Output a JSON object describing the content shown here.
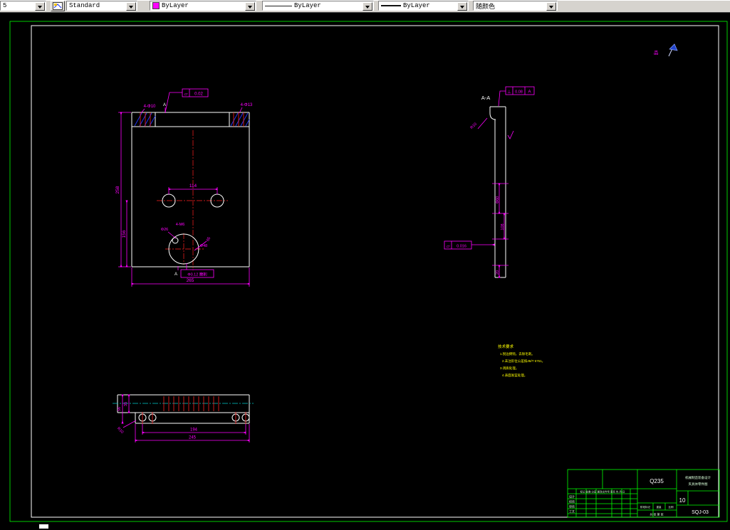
{
  "toolbar": {
    "left_combo_value": "5",
    "text_style": "Standard",
    "color": "ByLayer",
    "linetype": "ByLayer",
    "lineweight": "ByLayer",
    "plot_style": "随颜色"
  },
  "colors": {
    "dimension": "#ff00ff",
    "outline": "#ffffff",
    "centerline": "#ff2020",
    "hatch": "#2233ee",
    "frame": "#00ff00",
    "notes": "#ffff00",
    "aux_centerline": "#00c8c8",
    "toolbar_bg": "#d6d3ce"
  },
  "front_view": {
    "holes_left": "4-Φ10",
    "holes_right": "4-Φ13",
    "fcf_symbol": "▱",
    "fcf_value": "0.02",
    "section_label_top": "A",
    "section_label_bottom": "A",
    "dim_width_holes": "114",
    "dim_height": "258",
    "dim_height2": "156",
    "dim_width": "265",
    "label_phi26": "Φ26",
    "label_m6": "4-M6",
    "label_phi48": "Φ48",
    "label_angle": "65",
    "basic_note": "Φ0.12 磨削"
  },
  "side_view": {
    "section_title": "A-A",
    "fcf_perp_symbol": "⊥",
    "fcf_perp_value": "0.08",
    "fcf_perp_datum": "A",
    "fillet": "R10",
    "dim_phi60": "Φ60",
    "dim_108": "108",
    "dim_20": "20",
    "fcf_flat_symbol": "▱",
    "fcf_flat_value": "0.016"
  },
  "bottom_view": {
    "dim_35": "35",
    "dim_56": "56",
    "fillet": "R10",
    "dim_194": "194",
    "dim_245": "245"
  },
  "notes": {
    "title": "技术要求",
    "lines": [
      "1.锐边倒钝，去除毛刺。",
      "2.未注形位公差按JB/T 5751。",
      "3.调质处理。",
      "4.表面发蓝处理。"
    ]
  },
  "title_block": {
    "material": "Q235",
    "part_no": "SQJ-03",
    "qty": "10",
    "org_line1": "机械制造装备设计",
    "org_line2": "夹具体零件图",
    "header_row": "标记 处数 分区 更改文件号 签名 年.月.日",
    "rows": [
      "设计",
      "校核",
      "审核",
      "工艺"
    ],
    "stage": "阶段标记",
    "weight": "重量",
    "scale": "比例",
    "sheet": "共 张 第 张"
  },
  "markers": {
    "block_text": "品"
  }
}
